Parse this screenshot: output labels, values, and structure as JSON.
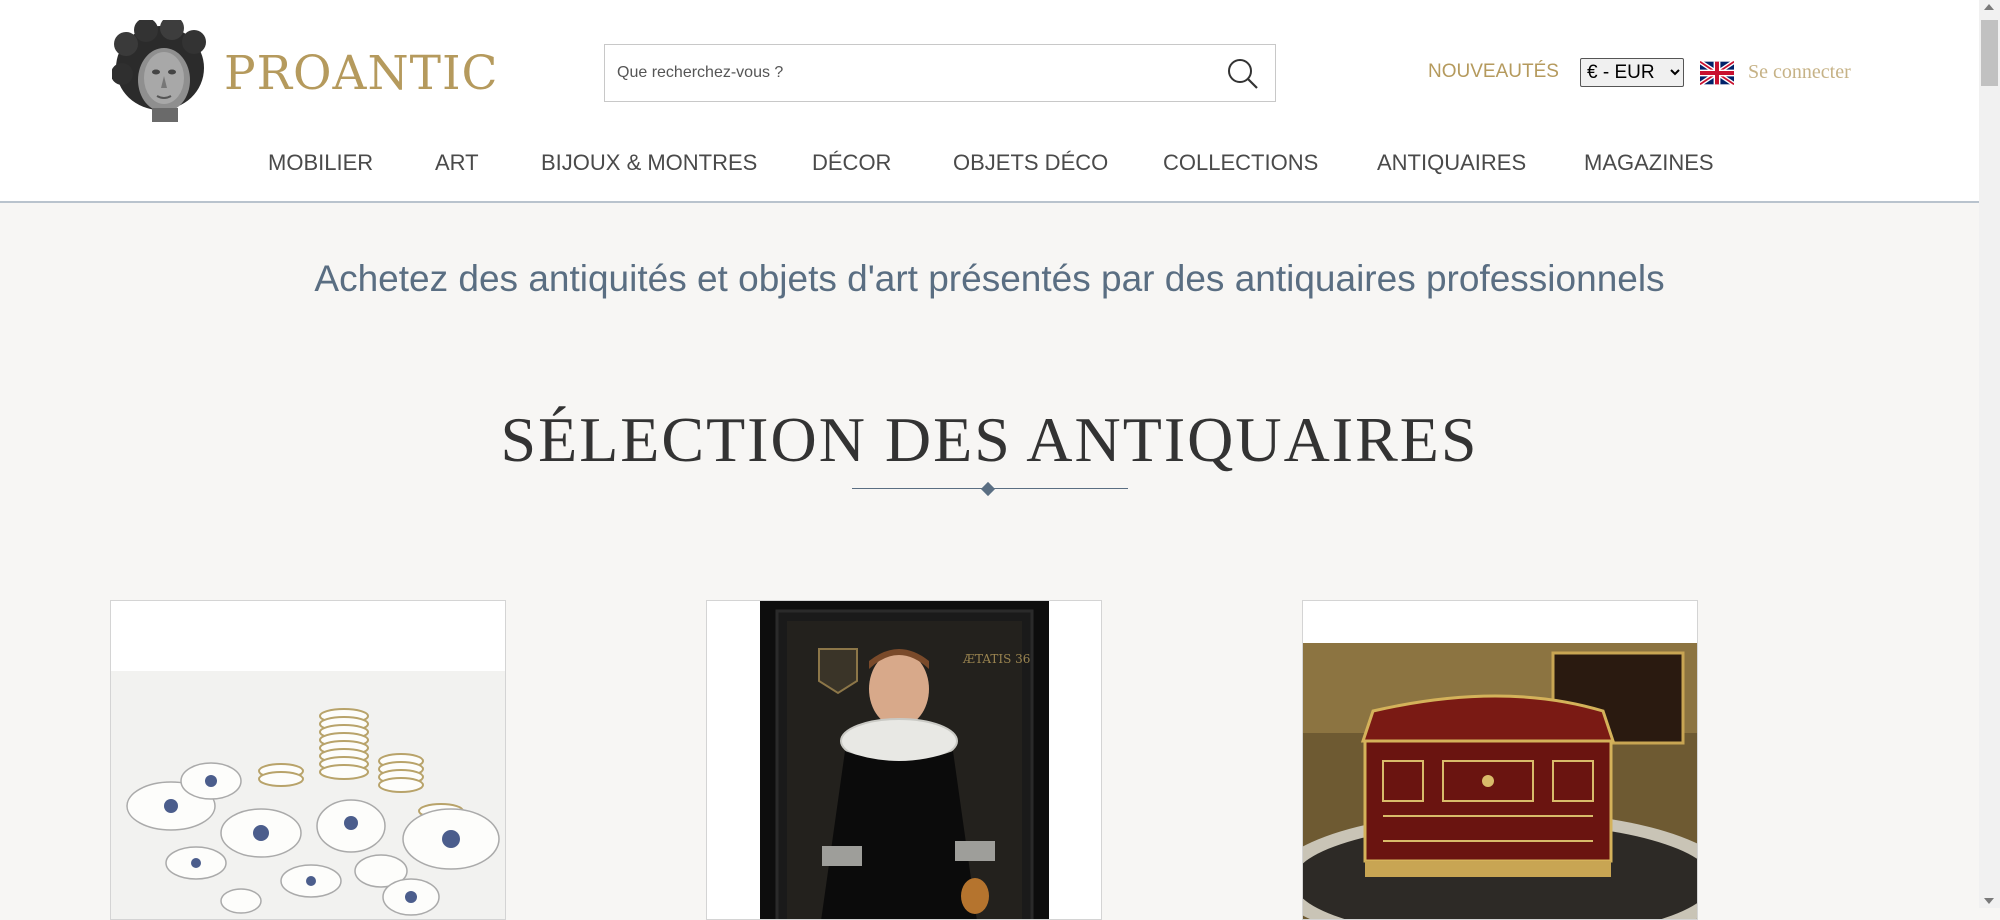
{
  "brand": {
    "name": "PROANTIC",
    "color": "#b59a5d"
  },
  "search": {
    "placeholder": "Que recherchez-vous ?",
    "value": ""
  },
  "header_links": {
    "nouveautes": "NOUVEAUTÉS",
    "currency_selected": "€ - EUR",
    "language_flag": "uk-flag-icon",
    "login": "Se connecter"
  },
  "nav": {
    "items": [
      {
        "label": "MOBILIER"
      },
      {
        "label": "ART"
      },
      {
        "label": "BIJOUX & MONTRES"
      },
      {
        "label": "DÉCOR"
      },
      {
        "label": "OBJETS DÉCO"
      },
      {
        "label": "COLLECTIONS"
      },
      {
        "label": "ANTIQUAIRES"
      },
      {
        "label": "MAGAZINES"
      }
    ]
  },
  "main": {
    "tagline": "Achetez des antiquités et objets d'art présentés par des antiquaires professionnels",
    "section_title": "SÉLECTION DES ANTIQUAIRES",
    "cards": [
      {
        "image": "porcelain-dinner-service-image"
      },
      {
        "image": "portrait-painting-image"
      },
      {
        "image": "boulle-jewelry-box-image"
      }
    ]
  },
  "colors": {
    "accent_gold": "#b59a5d",
    "slate": "#5a6e82",
    "background": "#f7f6f4"
  }
}
